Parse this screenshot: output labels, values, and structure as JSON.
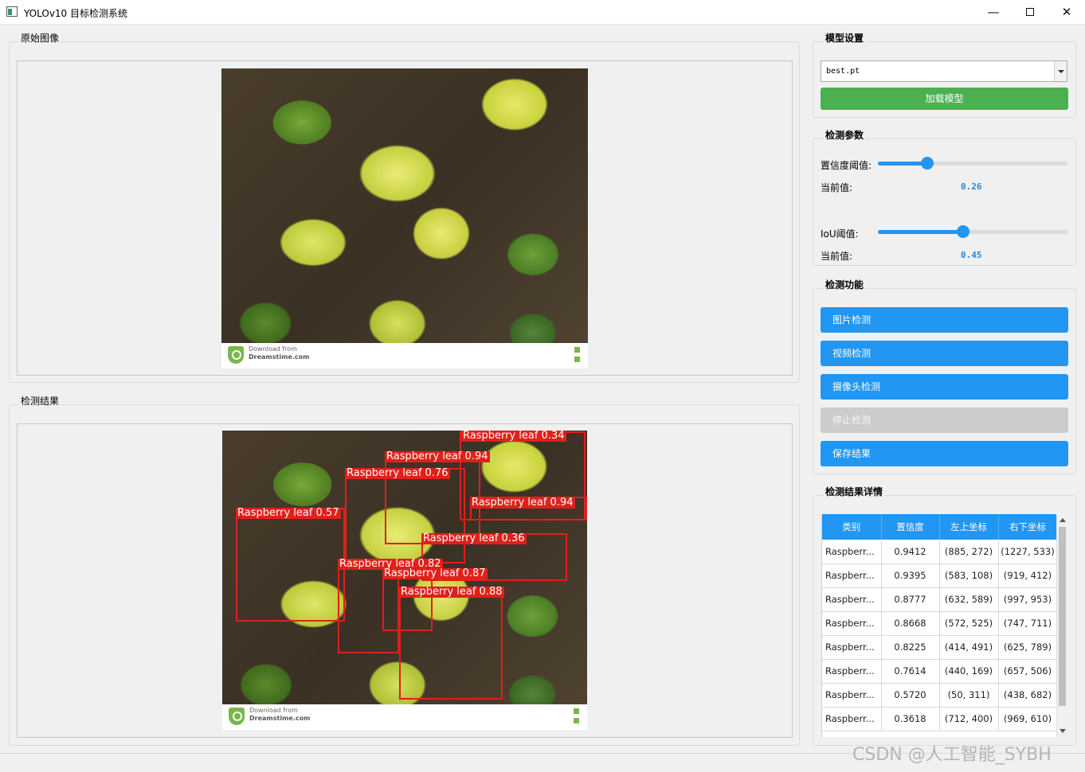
{
  "window": {
    "title": "YOLOv10 目标检测系统"
  },
  "original_group": {
    "title": "原始图像"
  },
  "result_group": {
    "title": "检测结果"
  },
  "photo": {
    "footer_line1": "Download from",
    "footer_line2": "Dreamstime.com"
  },
  "detections": [
    {
      "label": "Raspberry leaf 0.34"
    },
    {
      "label": "Raspberry leaf 0.94"
    },
    {
      "label": "Raspberry leaf 0.76"
    },
    {
      "label": "Raspberry leaf 0.94"
    },
    {
      "label": "Raspberry leaf 0.57"
    },
    {
      "label": "Raspberry leaf 0.36"
    },
    {
      "label": "Raspberry leaf 0.82"
    },
    {
      "label": "Raspberry leaf 0.87"
    },
    {
      "label": "Raspberry leaf 0.88"
    }
  ],
  "model_settings": {
    "title": "模型设置",
    "model_value": "best.pt",
    "load_button": "加载模型"
  },
  "params": {
    "title": "检测参数",
    "conf_label": "置信度阈值:",
    "conf_current_label": "当前值:",
    "conf_value": "0.26",
    "conf_fraction": 0.26,
    "iou_label": "IoU阈值:",
    "iou_current_label": "当前值:",
    "iou_value": "0.45",
    "iou_fraction": 0.45
  },
  "functions": {
    "title": "检测功能",
    "image_btn": "图片检测",
    "video_btn": "视频检测",
    "camera_btn": "摄像头检测",
    "stop_btn": "停止检测",
    "save_btn": "保存结果"
  },
  "results": {
    "title": "检测结果详情",
    "headers": [
      "类别",
      "置信度",
      "左上坐标",
      "右下坐标"
    ],
    "rows": [
      [
        "Raspberr...",
        "0.9412",
        "(885, 272)",
        "(1227, 533)"
      ],
      [
        "Raspberr...",
        "0.9395",
        "(583, 108)",
        "(919, 412)"
      ],
      [
        "Raspberr...",
        "0.8777",
        "(632, 589)",
        "(997, 953)"
      ],
      [
        "Raspberr...",
        "0.8668",
        "(572, 525)",
        "(747, 711)"
      ],
      [
        "Raspberr...",
        "0.8225",
        "(414, 491)",
        "(625, 789)"
      ],
      [
        "Raspberr...",
        "0.7614",
        "(440, 169)",
        "(657, 506)"
      ],
      [
        "Raspberr...",
        "0.5720",
        "(50, 311)",
        "(438, 682)"
      ],
      [
        "Raspberr...",
        "0.3618",
        "(712, 400)",
        "(969, 610)"
      ]
    ]
  },
  "watermark": "CSDN @人工智能_SYBH"
}
